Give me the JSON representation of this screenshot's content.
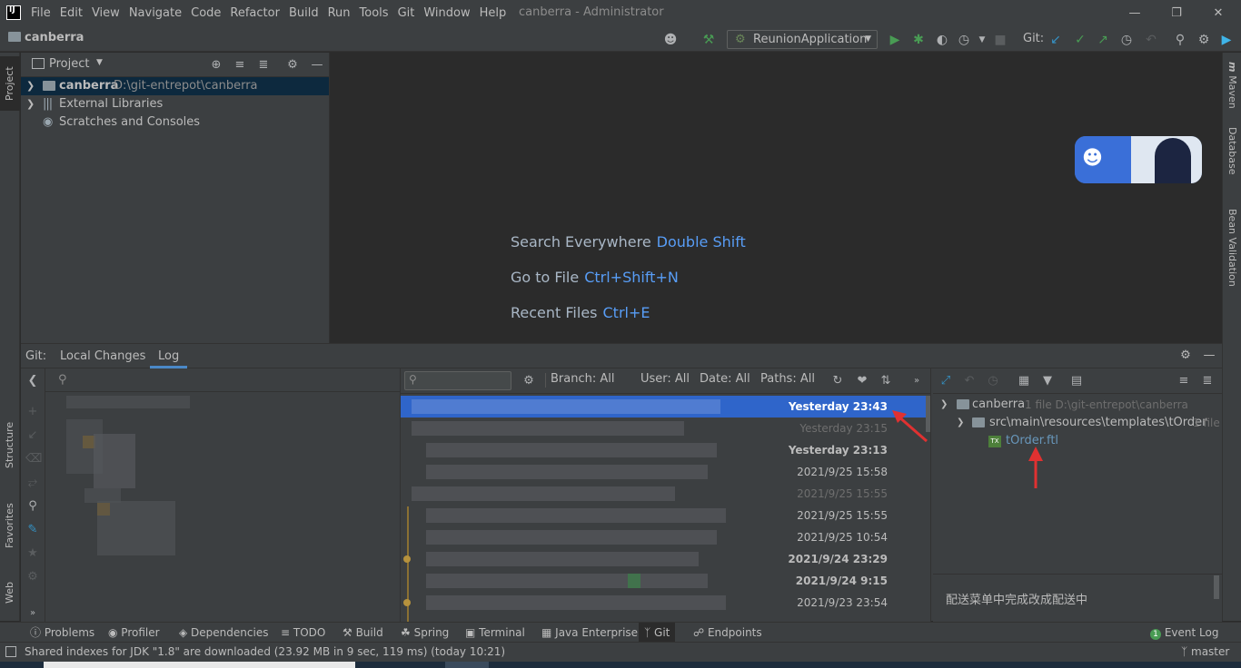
{
  "window": {
    "title": "canberra - Administrator",
    "menu": [
      "File",
      "Edit",
      "View",
      "Navigate",
      "Code",
      "Refactor",
      "Build",
      "Run",
      "Tools",
      "Git",
      "Window",
      "Help"
    ],
    "logo": "IJ"
  },
  "navbar": {
    "project": "canberra",
    "run_config": "ReunionApplication",
    "git_label": "Git:"
  },
  "left_stripe": [
    "Project",
    "Structure",
    "Favorites",
    "Web"
  ],
  "right_stripe": [
    "Maven",
    "Database",
    "Bean Validation"
  ],
  "project_panel": {
    "title": "Project",
    "tree": [
      {
        "name": "canberra",
        "path": "D:\\git-entrepot\\canberra",
        "selected": true
      },
      {
        "name": "External Libraries",
        "path": ""
      },
      {
        "name": "Scratches and Consoles",
        "path": ""
      }
    ]
  },
  "editor_hints": [
    {
      "label": "Search Everywhere",
      "key": "Double Shift"
    },
    {
      "label": "Go to File",
      "key": "Ctrl+Shift+N"
    },
    {
      "label": "Recent Files",
      "key": "Ctrl+E"
    }
  ],
  "git": {
    "prefix": "Git:",
    "tabs": [
      "Local Changes",
      "Log"
    ],
    "active_tab": "Log",
    "filters": {
      "branch": "Branch: All",
      "user": "User: All",
      "date": "Date: All",
      "paths": "Paths: All"
    },
    "log_dates": [
      {
        "date": "Yesterday 23:43",
        "style": "bold",
        "selected": true
      },
      {
        "date": "Yesterday 23:15",
        "style": "dim"
      },
      {
        "date": "Yesterday 23:13",
        "style": "bold"
      },
      {
        "date": "2021/9/25 15:58",
        "style": "normal"
      },
      {
        "date": "2021/9/25 15:55",
        "style": "dim"
      },
      {
        "date": "2021/9/25 15:55",
        "style": "normal"
      },
      {
        "date": "2021/9/25 10:54",
        "style": "normal"
      },
      {
        "date": "2021/9/24 23:29",
        "style": "bold"
      },
      {
        "date": "2021/9/24 9:15",
        "style": "bold"
      },
      {
        "date": "2021/9/23 23:54",
        "style": "normal"
      }
    ],
    "changes_tree": {
      "root": "canberra",
      "root_meta": "1 file  D:\\git-entrepot\\canberra",
      "folder": "src\\main\\resources\\templates\\tOrder",
      "folder_meta": "1 file",
      "file": "tOrder.ftl"
    },
    "commit_message": "配送菜单中完成改成配送中"
  },
  "bottom_tools": [
    "Problems",
    "Profiler",
    "Dependencies",
    "TODO",
    "Build",
    "Spring",
    "Terminal",
    "Java Enterprise",
    "Git",
    "Endpoints"
  ],
  "event_log": {
    "count": "1",
    "label": "Event Log"
  },
  "status": {
    "message": "Shared indexes for JDK \"1.8\" are downloaded (23.92 MB in 9 sec, 119 ms) (today 10:21)",
    "branch": "master"
  },
  "colors": {
    "bg": "#2b2b2b",
    "panel": "#3c3f41",
    "accent": "#589df6",
    "selection": "#2f65ca",
    "green": "#499c54",
    "red_annotation": "#e03131"
  }
}
